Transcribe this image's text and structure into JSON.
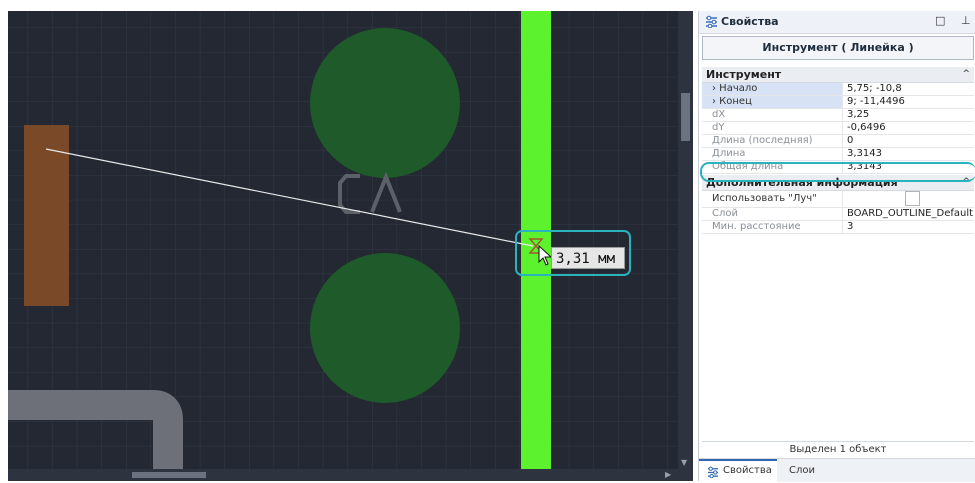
{
  "canvas": {
    "background": "#232833",
    "tooltip_text": "3,31 мм",
    "board_text": "CΛ"
  },
  "panel": {
    "title": "Свойства",
    "restore_glyph": "□",
    "pin_glyph": "⊥",
    "tool_title": "Инструмент ( Линейка )",
    "sections": [
      {
        "title": "Инструмент",
        "rows": [
          {
            "name": "› Начало",
            "value": "5,75; -10,8",
            "muted": false,
            "selected": true
          },
          {
            "name": "› Конец",
            "value": "9; -11,4496",
            "muted": false,
            "selected": true
          },
          {
            "name": "dX",
            "value": "3,25",
            "muted": true,
            "selected": false
          },
          {
            "name": "dY",
            "value": "-0,6496",
            "muted": true,
            "selected": false
          },
          {
            "name": "Длина (последняя)",
            "value": "0",
            "muted": true,
            "selected": false
          },
          {
            "name": "Длина",
            "value": "3,3143",
            "muted": true,
            "selected": false
          },
          {
            "name": "Общая длина",
            "value": "3,3143",
            "muted": true,
            "selected": false
          }
        ]
      },
      {
        "title": "Дополнительная информация",
        "rows": [
          {
            "name": "Использовать \"Луч\"",
            "value": "",
            "checkbox": true,
            "checked": false
          },
          {
            "name": "Слой",
            "value": "BOARD_OUTLINE_Default"
          },
          {
            "name": "Мин. расстояние",
            "value": "3"
          }
        ]
      }
    ],
    "collapse_caret": "^",
    "status": "Выделен 1 объект",
    "tabs": [
      {
        "label": "Свойства",
        "active": true,
        "icon": "properties-icon"
      },
      {
        "label": "Слои",
        "active": false
      }
    ]
  },
  "colors": {
    "accent_highlight": "#2ab2bd",
    "trace_green": "#5cf22e",
    "pad_green": "#1e5a2a",
    "pad_brown": "#7a4a28",
    "outline_gray": "#6d7078"
  }
}
